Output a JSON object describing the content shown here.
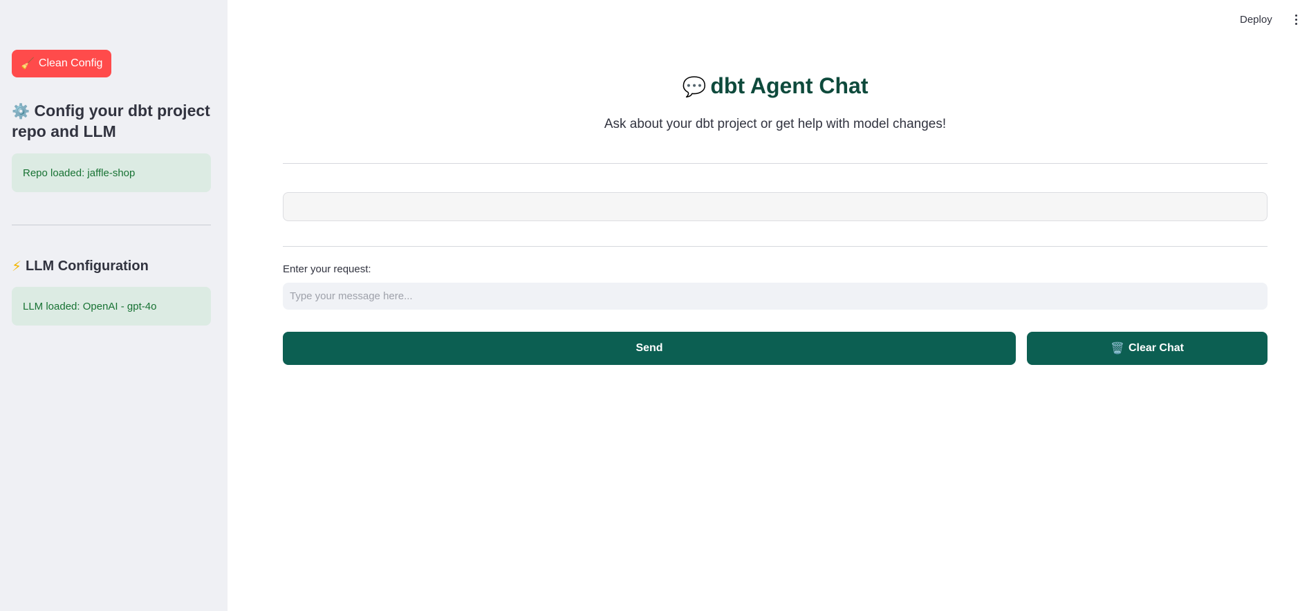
{
  "sidebar": {
    "clean_button": {
      "icon": "🧹",
      "label": "Clean Config"
    },
    "heading": {
      "icon": "⚙️",
      "text": "Config your dbt project repo and LLM"
    },
    "repo_status": "Repo loaded: jaffle-shop",
    "llm_heading": {
      "icon": "⚡",
      "text": "LLM Configuration"
    },
    "llm_status": "LLM loaded: OpenAI - gpt-4o"
  },
  "toolbar": {
    "deploy_label": "Deploy",
    "menu_icon": "vertical-ellipsis-icon"
  },
  "main": {
    "title": {
      "icon": "💬",
      "text": "dbt Agent Chat"
    },
    "subtitle": "Ask about your dbt project or get help with model changes!",
    "chat_history": "",
    "input_label": "Enter your request:",
    "input_value": "",
    "input_placeholder": "Type your message here...",
    "send_label": "Send",
    "clear_icon": "🗑️",
    "clear_label": "Clear Chat"
  },
  "colors": {
    "sidebar_bg": "#eff0f4",
    "danger_button": "#ff4b4b",
    "primary_button": "#0c5f52",
    "title_color": "#0e4a3c",
    "success_bg": "#dcebe3",
    "success_text": "#177233"
  }
}
